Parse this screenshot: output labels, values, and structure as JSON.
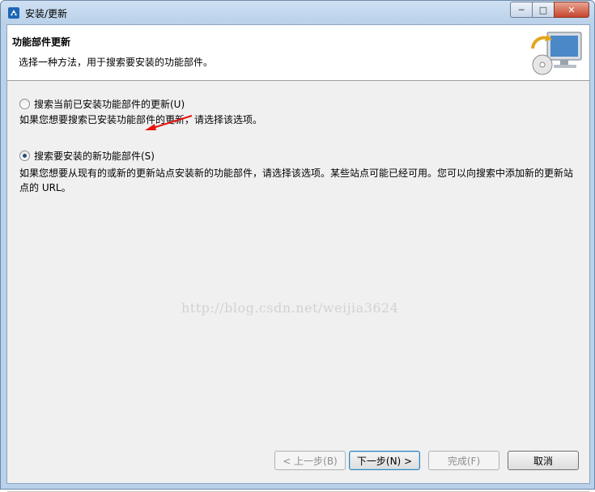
{
  "window": {
    "title": "安装/更新",
    "app_icon": "eclipse-update-icon",
    "controls": {
      "minimize": "minimize-icon",
      "maximize": "maximize-icon",
      "close": "close-icon"
    }
  },
  "banner": {
    "title": "功能部件更新",
    "description": "选择一种方法，用于搜索要安装的功能部件。",
    "icon": "monitor-cd-update-icon"
  },
  "options": [
    {
      "label": "搜索当前已安装功能部件的更新(U)",
      "description": "如果您想要搜索已安装功能部件的更新，请选择该选项。",
      "selected": false
    },
    {
      "label": "搜索要安装的新功能部件(S)",
      "description": "如果您想要从现有的或新的更新站点安装新的功能部件，请选择该选项。某些站点可能已经可用。您可以向搜索中添加新的更新站点的 URL。",
      "selected": true
    }
  ],
  "watermark": "http://blog.csdn.net/weijia3624",
  "buttons": {
    "back": "< 上一步(B)",
    "next": "下一步(N) >",
    "finish": "完成(F)",
    "cancel": "取消"
  },
  "colors": {
    "annotation_arrow": "#e8140f"
  }
}
